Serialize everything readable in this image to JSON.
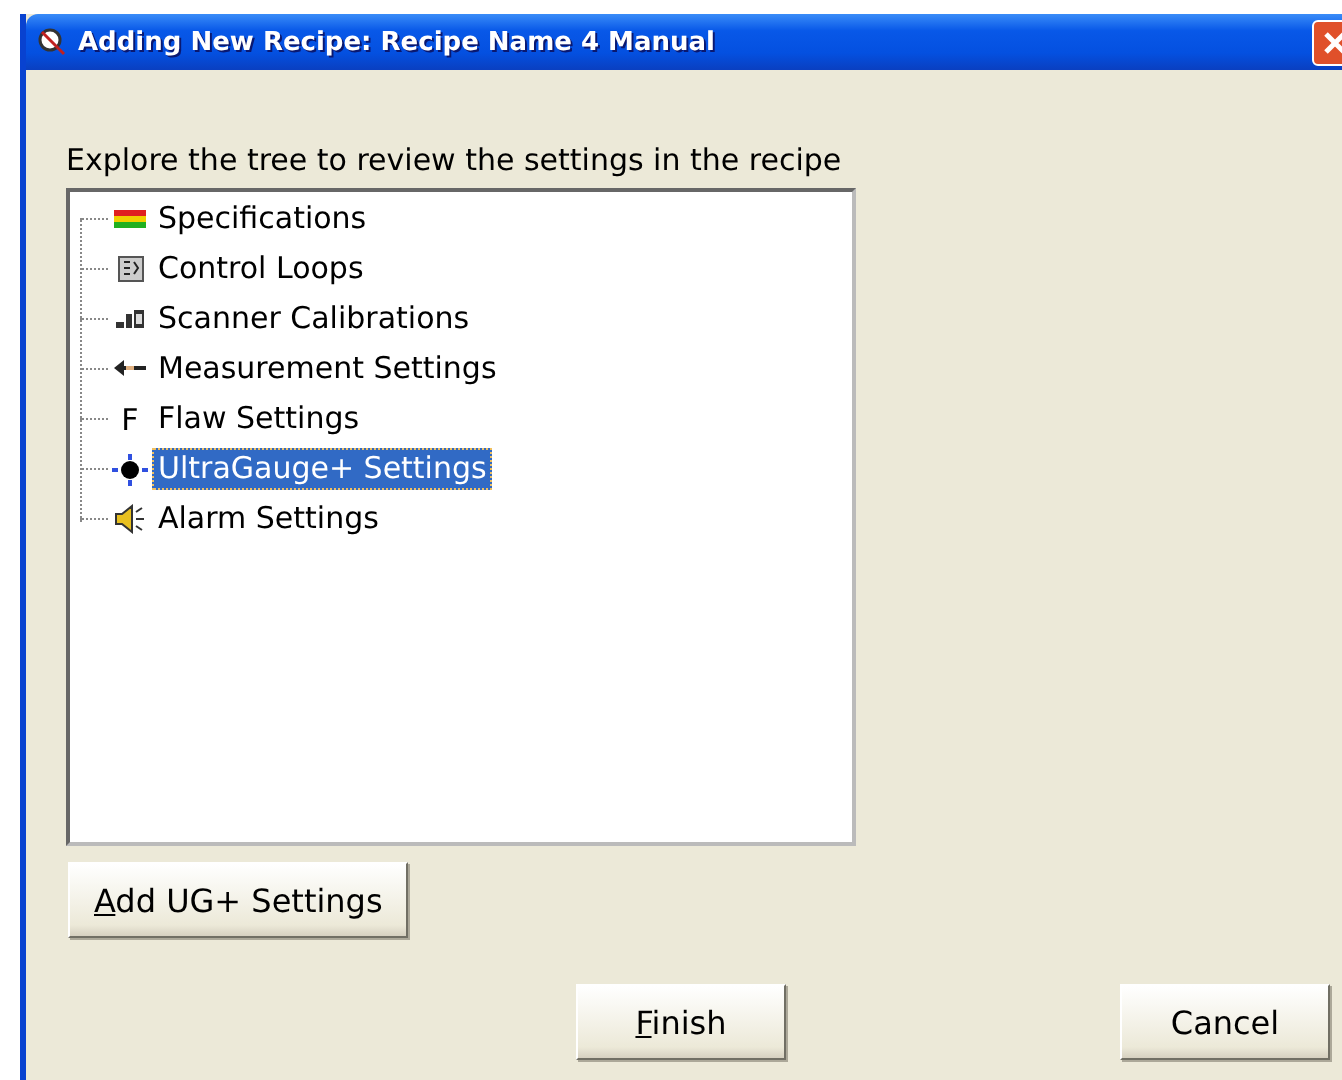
{
  "window": {
    "title": "Adding New Recipe: Recipe Name 4 Manual"
  },
  "instruction": "Explore the tree to review the settings in the recipe",
  "tree": {
    "items": [
      {
        "label": "Specifications",
        "kind": "specs",
        "selected": false
      },
      {
        "label": "Control Loops",
        "kind": "loops",
        "selected": false
      },
      {
        "label": "Scanner Calibrations",
        "kind": "scanner",
        "selected": false
      },
      {
        "label": "Measurement Settings",
        "kind": "measure",
        "selected": false
      },
      {
        "label": "Flaw Settings",
        "kind": "letter",
        "icon_text": "F",
        "selected": false
      },
      {
        "label": "UltraGauge+ Settings",
        "kind": "gauge",
        "selected": true
      },
      {
        "label": "Alarm Settings",
        "kind": "alarm",
        "selected": false
      }
    ]
  },
  "buttons": [
    {
      "label": "Add UG+ Settings",
      "underline_first": true
    },
    {
      "label": "Finish",
      "underline_first": true
    },
    {
      "label": "Cancel",
      "underline_first": false
    }
  ]
}
